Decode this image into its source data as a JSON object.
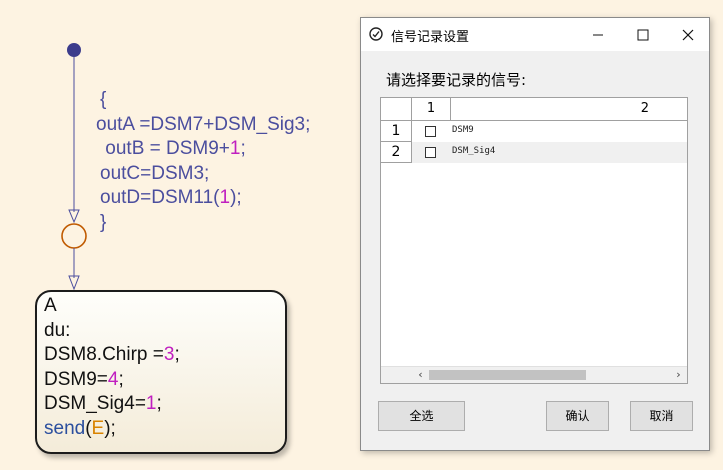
{
  "stateflow": {
    "transition_code": [
      "{",
      "outA =DSM7+DSM_Sig3;",
      " outB = DSM9+",
      "1",
      ";",
      "outC=DSM3;",
      "outD=DSM11(",
      "1",
      ");",
      "}"
    ],
    "state": {
      "name": "A",
      "action_label": "du:",
      "line1_pre": "DSM8.Chirp =",
      "line1_num": "3",
      "line1_post": ";",
      "line2_pre": "DSM9=",
      "line2_num": "4",
      "line2_post": ";",
      "line3_pre": "DSM_Sig4=",
      "line3_num": "1",
      "line3_post": ";",
      "send_kw": "send",
      "send_open": "(",
      "send_arg": "E",
      "send_close": ");"
    }
  },
  "dialog": {
    "title": "信号记录设置",
    "prompt": "请选择要记录的信号:",
    "table": {
      "col_headers": [
        "1",
        "2"
      ],
      "rows": [
        {
          "index": "1",
          "checked": false,
          "name": "DSM9"
        },
        {
          "index": "2",
          "checked": false,
          "name": "DSM_Sig4"
        }
      ]
    },
    "buttons": {
      "select_all": "全选",
      "confirm": "确认",
      "cancel": "取消"
    },
    "window_controls": {
      "minimize": "—",
      "maximize": "☐",
      "close": "✕"
    }
  },
  "colors": {
    "canvas_bg": "#fdf3e2",
    "code_text": "#4b4e9e",
    "numeric_literal": "#c01fc0",
    "junction_stroke": "#c05a00",
    "default_transition_dot": "#3c3c8c",
    "selected_row_bg": "#f0f0f0"
  }
}
